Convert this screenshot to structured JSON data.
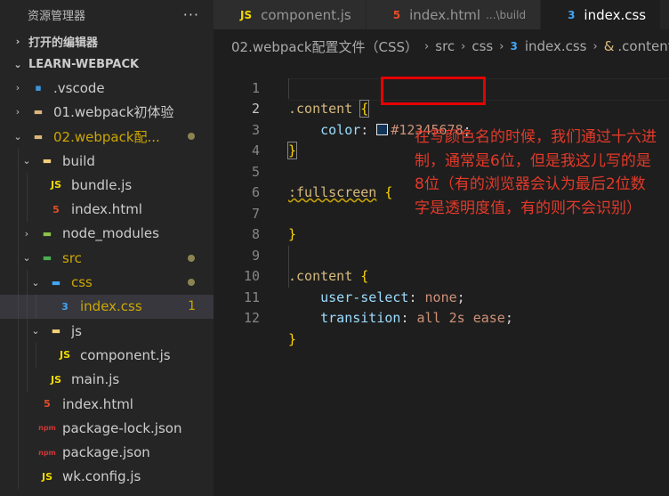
{
  "sidebar": {
    "title": "资源管理器",
    "more": "···",
    "open_editors": "打开的编辑器",
    "project": "LEARN-WEBPACK",
    "tree": [
      {
        "label": ".vscode",
        "chev": "›",
        "icon": "vscode-folder-icon",
        "glyph": "▪",
        "color": "#3a96dd",
        "depth": 1
      },
      {
        "label": "01.webpack初体验",
        "chev": "›",
        "icon": "folder-icon",
        "glyph": "▬",
        "color": "#dcb67a",
        "depth": 1
      },
      {
        "label": "02.webpack配...",
        "chev": "⌄",
        "icon": "folder-open-icon",
        "glyph": "▬",
        "color": "#dcb67a",
        "depth": 1,
        "modified": true,
        "dot": true
      },
      {
        "label": "build",
        "chev": "⌄",
        "icon": "folder-open-icon",
        "glyph": "▬",
        "color": "#f4d078",
        "depth": 2
      },
      {
        "label": "bundle.js",
        "icon": "js-file-icon",
        "glyph": "JS",
        "color": "#f1d900",
        "depth": 3
      },
      {
        "label": "index.html",
        "icon": "html-file-icon",
        "glyph": "5",
        "color": "#e44d26",
        "depth": 3
      },
      {
        "label": "node_modules",
        "chev": "›",
        "icon": "node-folder-icon",
        "glyph": "▬",
        "color": "#8bc34a",
        "depth": 2
      },
      {
        "label": "src",
        "chev": "⌄",
        "icon": "src-folder-icon",
        "glyph": "▬",
        "color": "#4caf50",
        "depth": 2,
        "modified": true,
        "dot": true
      },
      {
        "label": "css",
        "chev": "⌄",
        "icon": "css-folder-icon",
        "glyph": "▬",
        "color": "#42a5f5",
        "depth": 3,
        "modified": true,
        "dot": true
      },
      {
        "label": "index.css",
        "icon": "css-file-icon",
        "glyph": "3",
        "color": "#42a5f5",
        "depth": 4,
        "modified": true,
        "count": "1",
        "selected": true
      },
      {
        "label": "js",
        "chev": "⌄",
        "icon": "js-folder-icon",
        "glyph": "▬",
        "color": "#f4d078",
        "depth": 3
      },
      {
        "label": "component.js",
        "icon": "js-file-icon",
        "glyph": "JS",
        "color": "#f1d900",
        "depth": 4
      },
      {
        "label": "main.js",
        "icon": "js-file-icon",
        "glyph": "JS",
        "color": "#f1d900",
        "depth": 3
      },
      {
        "label": "index.html",
        "icon": "html-file-icon",
        "glyph": "5",
        "color": "#e44d26",
        "depth": 2
      },
      {
        "label": "package-lock.json",
        "icon": "npm-file-icon",
        "glyph": "npm",
        "color": "#cb3837",
        "depth": 2
      },
      {
        "label": "package.json",
        "icon": "npm-file-icon",
        "glyph": "npm",
        "color": "#cb3837",
        "depth": 2
      },
      {
        "label": "wk.config.js",
        "icon": "js-file-icon",
        "glyph": "JS",
        "color": "#f1d900",
        "depth": 2
      }
    ]
  },
  "tabs": [
    {
      "label": "component.js",
      "icon": "js-file-icon",
      "glyph": "JS",
      "color": "#f1d900"
    },
    {
      "label": "index.html",
      "hint": "...\\build",
      "icon": "html-file-icon",
      "glyph": "5",
      "color": "#e44d26"
    },
    {
      "label": "index.css",
      "icon": "css-file-icon",
      "glyph": "3",
      "color": "#42a5f5",
      "active": true
    }
  ],
  "breadcrumb": {
    "folder": "02.webpack配置文件（CSS）",
    "src": "src",
    "css": "css",
    "file": "index.css",
    "symbol": ".content"
  },
  "editor": {
    "line_numbers": [
      "1",
      "2",
      "3",
      "4",
      "5",
      "6",
      "7",
      "8",
      "9",
      "10",
      "11",
      "12"
    ],
    "current_line": "2",
    "code": {
      "l1_selector": ".content",
      "l1_brace": "{",
      "l2_prop": "color",
      "l2_value": "#12345678",
      "l3_brace": "}",
      "l5_selector": ":fullscreen",
      "l5_brace": "{",
      "l7_brace": "}",
      "l9_selector": ".content",
      "l9_brace": "{",
      "l10_prop": "user-select",
      "l10_value": "none",
      "l11_prop": "transition",
      "l11_value": "all 2s ease",
      "l12_brace": "}"
    },
    "swatch_color": "#123456"
  },
  "annotation": "在写颜色名的时候，我们通过十六进制，通常是6位，但是我这儿写的是8位（有的浏览器会认为最后2位数字是透明度值，有的则不会识别）"
}
